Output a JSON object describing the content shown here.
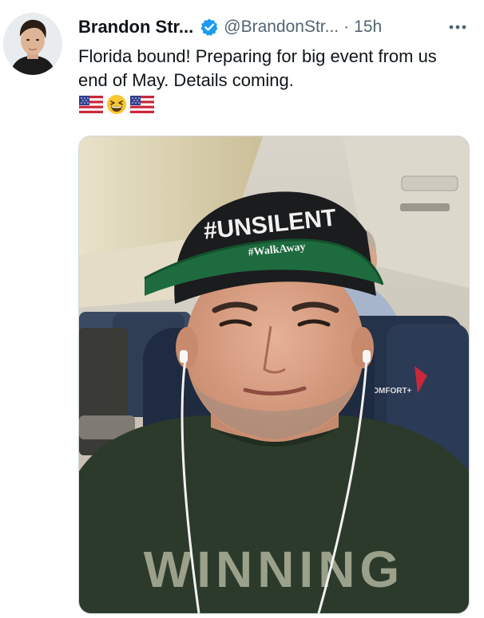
{
  "author": {
    "display_name": "Brandon Str...",
    "handle": "@BrandonStr...",
    "separator": "·",
    "timestamp": "15h",
    "verified": true
  },
  "tweet": {
    "text": "Florida bound! Preparing for big event from us end of May. Details coming.",
    "emojis": [
      "us-flag-emoji",
      "grinning-squinting-emoji",
      "us-flag-emoji"
    ]
  },
  "media": {
    "hat_text_main": "#UNSILENT",
    "hat_text_sub": "#WalkAway",
    "seat_label": "COMFORT+",
    "shirt_text": "WINNING"
  },
  "colors": {
    "verified_blue": "#1d9bf0",
    "secondary_text": "#536471",
    "primary_text": "#0f1419",
    "border": "#cfd9de"
  }
}
